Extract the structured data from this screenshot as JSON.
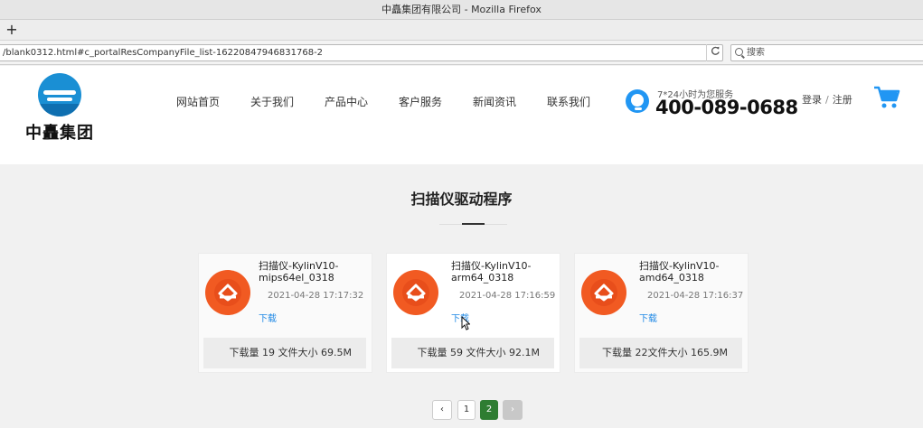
{
  "window": {
    "title": "中矗集团有限公司 - Mozilla Firefox",
    "new_tab": "+"
  },
  "browser": {
    "url": "/blank0312.html#c_portalResCompanyFile_list-16220847946831768-2",
    "reload_icon": "reload-icon",
    "search_placeholder": "搜索"
  },
  "site": {
    "logo_text": "中矗集团",
    "nav": [
      "网站首页",
      "关于我们",
      "产品中心",
      "客户服务",
      "新闻资讯",
      "联系我们"
    ],
    "hotline_sub": "7*24小时为您服务",
    "hotline_number": "400-089-0688",
    "login": "登录",
    "separator": "/",
    "register": "注册",
    "brand_color": "#1a8fd4"
  },
  "main": {
    "title": "扫描仪驱动程序",
    "files": [
      {
        "name": "扫描仪-KylinV10-mips64el_0318",
        "date": "2021-04-28 17:17:32",
        "download_label": "下载",
        "stats": "下载量 19 文件大小 69.5M"
      },
      {
        "name": "扫描仪-KylinV10-arm64_0318",
        "date": "2021-04-28 17:16:59",
        "download_label": "下载",
        "stats": "下载量 59 文件大小 92.1M"
      },
      {
        "name": "扫描仪-KylinV10-amd64_0318",
        "date": "2021-04-28 17:16:37",
        "download_label": "下载",
        "stats": "下载量 22文件大小 165.9M"
      }
    ]
  },
  "pagination": {
    "prev": "‹",
    "pages": [
      "1",
      "2"
    ],
    "current": "2",
    "next": "›"
  }
}
